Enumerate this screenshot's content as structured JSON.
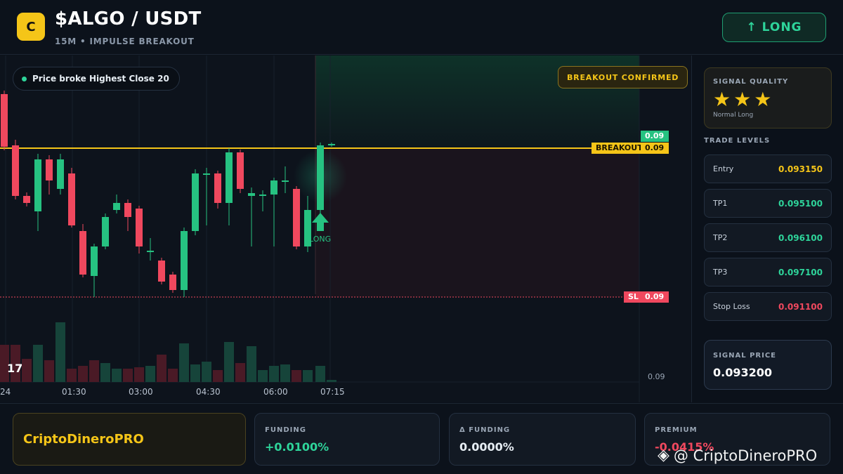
{
  "header": {
    "logo_letter": "C",
    "title": "$ALGO / USDT",
    "subtitle": "15M • IMPULSE BREAKOUT",
    "direction_button": "↑ LONG"
  },
  "chart": {
    "status_text": "Price broke Highest Close 20",
    "confirm_badge": "BREAKOUT CONFIRMED",
    "current_price_tag": "0.09",
    "breakout_label": "BREAKOUT",
    "breakout_value": "0.09",
    "sl_label": "SL",
    "sl_value": "0.09",
    "volume_axis_value": "0.09",
    "signal_marker_label": "LONG",
    "time_labels": [
      "24",
      "01:30",
      "03:00",
      "04:30",
      "06:00",
      "07:15"
    ],
    "tv_logo": "17",
    "colors": {
      "up": "#26c281",
      "down": "#f0485e",
      "breakout": "#f5c518",
      "sl": "#f0485e"
    }
  },
  "sidebar": {
    "quality_label": "SIGNAL QUALITY",
    "stars": "★★★",
    "quality_sub": "Normal Long",
    "levels_title": "TRADE LEVELS",
    "levels": [
      {
        "label": "Entry",
        "value": "0.093150",
        "color": "#f5c518"
      },
      {
        "label": "TP1",
        "value": "0.095100",
        "color": "#2ed49a"
      },
      {
        "label": "TP2",
        "value": "0.096100",
        "color": "#2ed49a"
      },
      {
        "label": "TP3",
        "value": "0.097100",
        "color": "#2ed49a"
      },
      {
        "label": "Stop Loss",
        "value": "0.091100",
        "color": "#f0485e"
      }
    ],
    "signal_price_label": "SIGNAL PRICE",
    "signal_price": "0.093200"
  },
  "footer": {
    "brand": "CriptoDineroPRO",
    "stats": [
      {
        "label": "FUNDING",
        "value": "+0.0100%",
        "color": "#2ed49a"
      },
      {
        "label": "Δ FUNDING",
        "value": "0.0000%",
        "color": "#e6edf3"
      },
      {
        "label": "PREMIUM",
        "value": "-0.0415%",
        "color": "#f0485e"
      }
    ],
    "watermark": "@ CriptoDineroPRO"
  }
}
